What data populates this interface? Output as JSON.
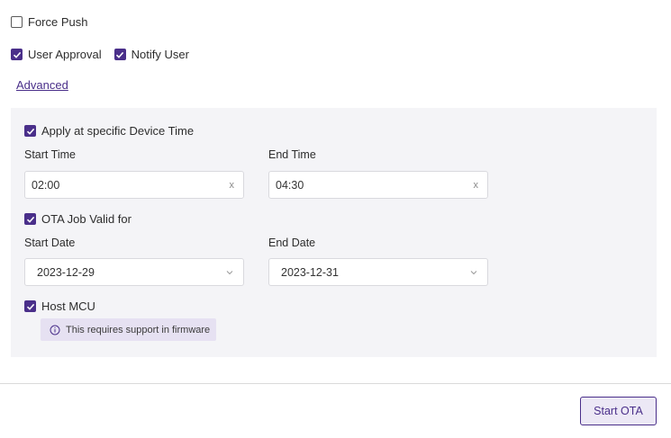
{
  "options": {
    "force_push": {
      "label": "Force Push",
      "checked": false
    },
    "user_approval": {
      "label": "User Approval",
      "checked": true
    },
    "notify_user": {
      "label": "Notify User",
      "checked": true
    }
  },
  "advanced_link": "Advanced",
  "advanced": {
    "device_time": {
      "label": "Apply at specific Device Time",
      "checked": true
    },
    "start_time": {
      "label": "Start Time",
      "value": "02:00",
      "clear": "x"
    },
    "end_time": {
      "label": "End Time",
      "value": "04:30",
      "clear": "x"
    },
    "job_valid": {
      "label": "OTA Job Valid for",
      "checked": true
    },
    "start_date": {
      "label": "Start Date",
      "value": "2023-12-29"
    },
    "end_date": {
      "label": "End Date",
      "value": "2023-12-31"
    },
    "host_mcu": {
      "label": "Host MCU",
      "checked": true
    },
    "firmware_note": "This requires support in firmware"
  },
  "footer": {
    "start_button": "Start OTA"
  },
  "colors": {
    "accent": "#4a2f8a",
    "panel_bg": "#f4f4f7",
    "note_bg": "#e6e1f2"
  }
}
